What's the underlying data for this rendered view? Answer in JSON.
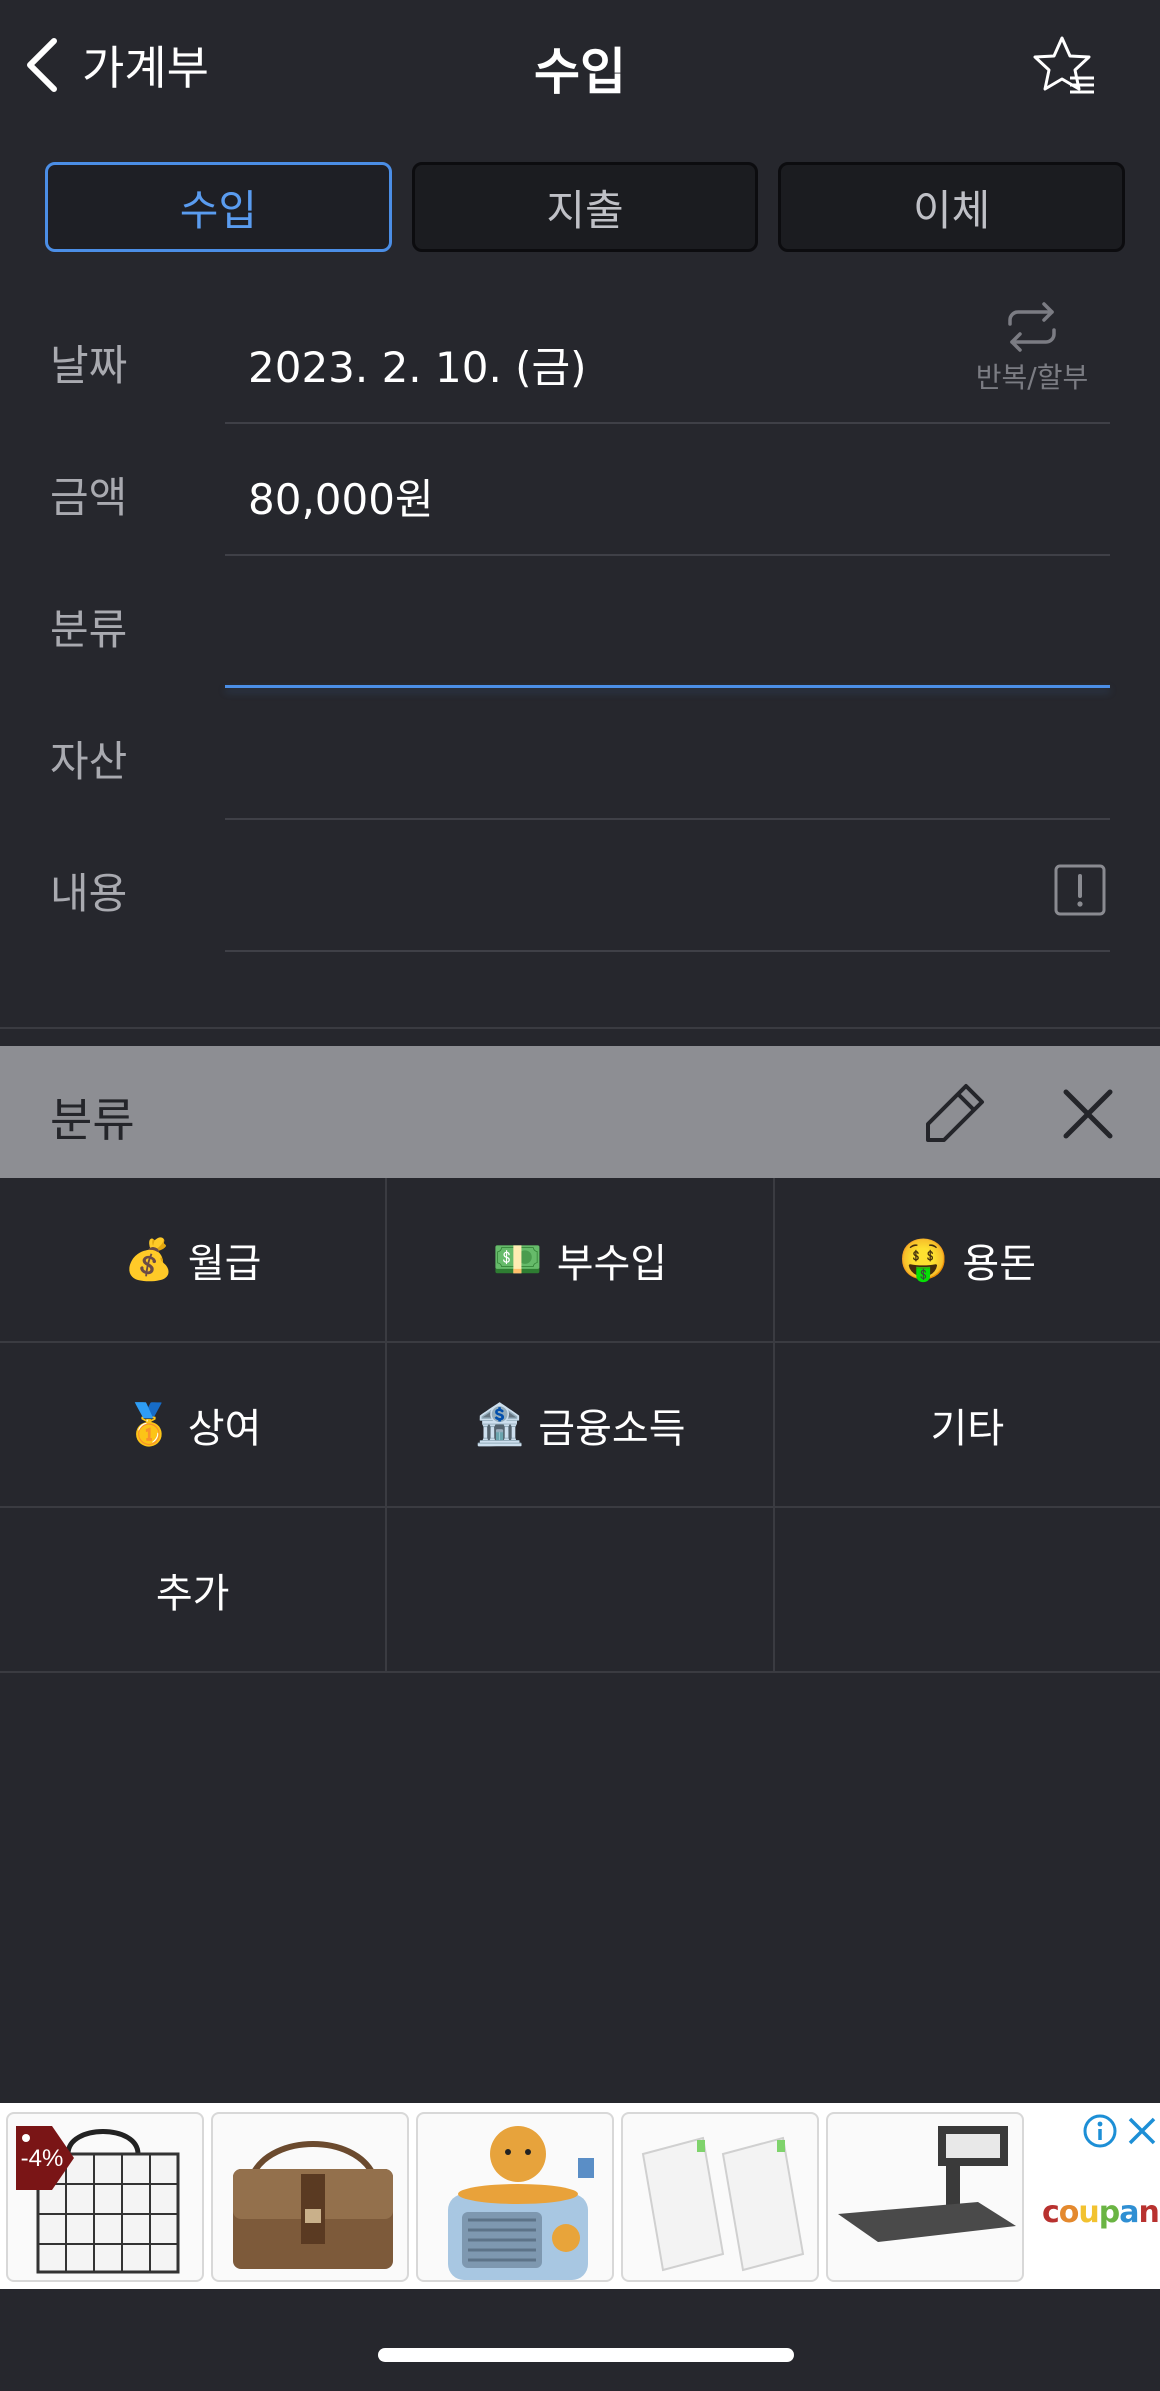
{
  "header": {
    "back_label": "가계부",
    "title": "수입",
    "back_icon": "chevron-left-icon",
    "favorite_icon": "star-list-icon"
  },
  "tabs": [
    {
      "label": "수입",
      "active": true
    },
    {
      "label": "지출",
      "active": false
    },
    {
      "label": "이체",
      "active": false
    }
  ],
  "form": {
    "date": {
      "label": "날짜",
      "value": "2023. 2. 10. (금)",
      "repeat_label": "반복/할부"
    },
    "amount": {
      "label": "금액",
      "value": "80,000원"
    },
    "category": {
      "label": "분류",
      "value": ""
    },
    "asset": {
      "label": "자산",
      "value": ""
    },
    "content": {
      "label": "내용",
      "value": ""
    }
  },
  "category_sheet": {
    "title": "분류",
    "rows": [
      [
        {
          "emoji": "💰",
          "label": "월급"
        },
        {
          "emoji": "💵",
          "label": "부수입"
        },
        {
          "emoji": "🤑",
          "label": "용돈"
        }
      ],
      [
        {
          "emoji": "🥇",
          "label": "상여"
        },
        {
          "emoji": "🏦",
          "label": "금융소득"
        },
        {
          "emoji": "",
          "label": "기타"
        }
      ],
      [
        {
          "emoji": "",
          "label": "추가"
        },
        {
          "emoji": "",
          "label": ""
        },
        {
          "emoji": "",
          "label": ""
        }
      ]
    ]
  },
  "ad": {
    "discount_badge": "-4%",
    "brand": "coupang",
    "items": [
      "grid-tote-bag",
      "leather-messenger-bag",
      "lion-speaker",
      "screen-protector-film",
      "keyboard-tray"
    ]
  },
  "colors": {
    "background": "#26272d",
    "accent": "#4b8ee6",
    "sheet_header": "#8d8e93"
  }
}
